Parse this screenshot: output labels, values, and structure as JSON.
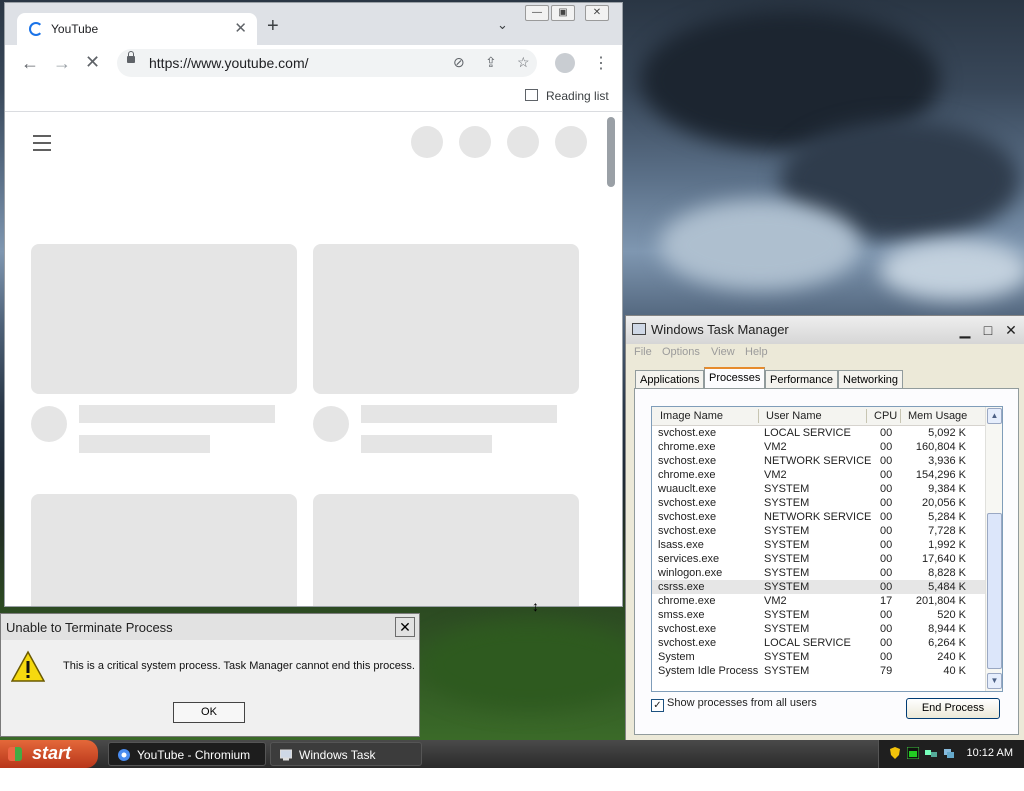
{
  "browser": {
    "tab_title": "YouTube",
    "url": "https://www.youtube.com/",
    "reading_list": "Reading list"
  },
  "taskmanager": {
    "title": "Windows Task Manager",
    "menu": [
      "File",
      "Options",
      "View",
      "Help"
    ],
    "tabs": [
      "Applications",
      "Processes",
      "Performance",
      "Networking"
    ],
    "active_tab": "Processes",
    "columns": [
      "Image Name",
      "User Name",
      "CPU",
      "Mem Usage"
    ],
    "rows": [
      {
        "name": "svchost.exe",
        "user": "LOCAL SERVICE",
        "cpu": "00",
        "mem": "5,092 K"
      },
      {
        "name": "chrome.exe",
        "user": "VM2",
        "cpu": "00",
        "mem": "160,804 K"
      },
      {
        "name": "svchost.exe",
        "user": "NETWORK SERVICE",
        "cpu": "00",
        "mem": "3,936 K"
      },
      {
        "name": "chrome.exe",
        "user": "VM2",
        "cpu": "00",
        "mem": "154,296 K"
      },
      {
        "name": "wuauclt.exe",
        "user": "SYSTEM",
        "cpu": "00",
        "mem": "9,384 K"
      },
      {
        "name": "svchost.exe",
        "user": "SYSTEM",
        "cpu": "00",
        "mem": "20,056 K"
      },
      {
        "name": "svchost.exe",
        "user": "NETWORK SERVICE",
        "cpu": "00",
        "mem": "5,284 K"
      },
      {
        "name": "svchost.exe",
        "user": "SYSTEM",
        "cpu": "00",
        "mem": "7,728 K"
      },
      {
        "name": "lsass.exe",
        "user": "SYSTEM",
        "cpu": "00",
        "mem": "1,992 K"
      },
      {
        "name": "services.exe",
        "user": "SYSTEM",
        "cpu": "00",
        "mem": "17,640 K"
      },
      {
        "name": "winlogon.exe",
        "user": "SYSTEM",
        "cpu": "00",
        "mem": "8,828 K"
      },
      {
        "name": "csrss.exe",
        "user": "SYSTEM",
        "cpu": "00",
        "mem": "5,484 K",
        "selected": true
      },
      {
        "name": "chrome.exe",
        "user": "VM2",
        "cpu": "17",
        "mem": "201,804 K"
      },
      {
        "name": "smss.exe",
        "user": "SYSTEM",
        "cpu": "00",
        "mem": "520 K"
      },
      {
        "name": "svchost.exe",
        "user": "SYSTEM",
        "cpu": "00",
        "mem": "8,944 K"
      },
      {
        "name": "svchost.exe",
        "user": "LOCAL SERVICE",
        "cpu": "00",
        "mem": "6,264 K"
      },
      {
        "name": "System",
        "user": "SYSTEM",
        "cpu": "00",
        "mem": "240 K"
      },
      {
        "name": "System Idle Process",
        "user": "SYSTEM",
        "cpu": "79",
        "mem": "40 K"
      }
    ],
    "show_all_label": "Show processes from all users",
    "show_all_checked": true,
    "end_process_label": "End Process"
  },
  "dialog": {
    "title": "Unable to Terminate Process",
    "message": "This is a critical system process.  Task Manager cannot end this process.",
    "ok_label": "OK"
  },
  "taskbar": {
    "start_label": "start",
    "tasks": [
      "YouTube - Chromium",
      "Windows Task Manager"
    ],
    "clock": "10:12 AM"
  },
  "colors": {
    "accent_tab": "#e68b2c",
    "chrome_blue": "#1a73e8",
    "start_button": "#c9461f"
  }
}
